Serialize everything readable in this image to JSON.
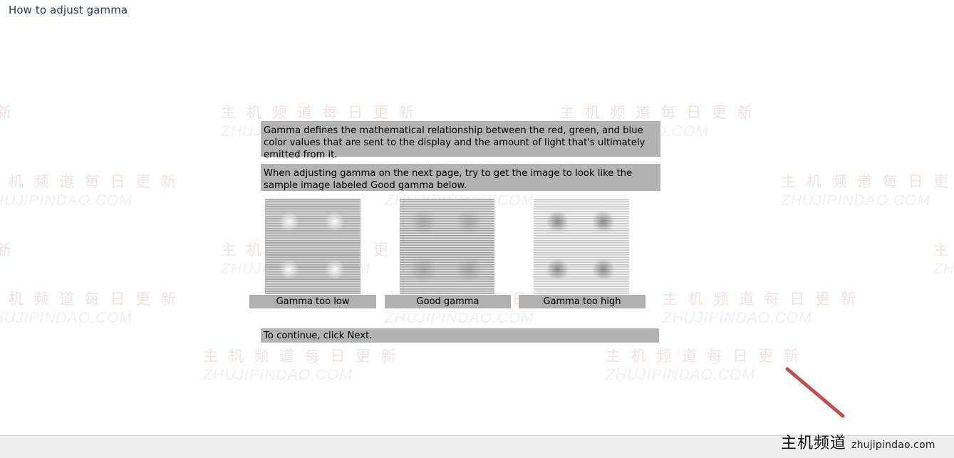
{
  "page": {
    "title": "How to adjust gamma",
    "title_color": "#1f3a55",
    "background": "#ffffff",
    "text_block_color": "#b3b3b3"
  },
  "content": {
    "intro_paragraph": "Gamma defines the mathematical relationship between the red, green, and blue color values that are sent to the display and the amount of light that's ultimately emitted from it.",
    "instruction_paragraph": "When adjusting gamma on the next page, try to get the image to look like the sample image labeled Good gamma below.",
    "continue_text": "To continue, click Next."
  },
  "samples": [
    {
      "id": "gamma-too-low",
      "caption": "Gamma too low"
    },
    {
      "id": "good-gamma",
      "caption": "Good gamma"
    },
    {
      "id": "gamma-too-high",
      "caption": "Gamma too high"
    }
  ],
  "watermark": {
    "chinese": "主 机 频 道  每 日 更 新",
    "english": "ZHUJIPINDAO.COM",
    "chinese_color": "#f1e3e3",
    "english_color": "#f0f0f0"
  },
  "brand": {
    "chinese": "主机频道",
    "domain": "zhujipindao.com",
    "accent_color": "#c0504d"
  },
  "footer": {
    "background": "#efefef",
    "border_color": "#d8d8d8"
  }
}
